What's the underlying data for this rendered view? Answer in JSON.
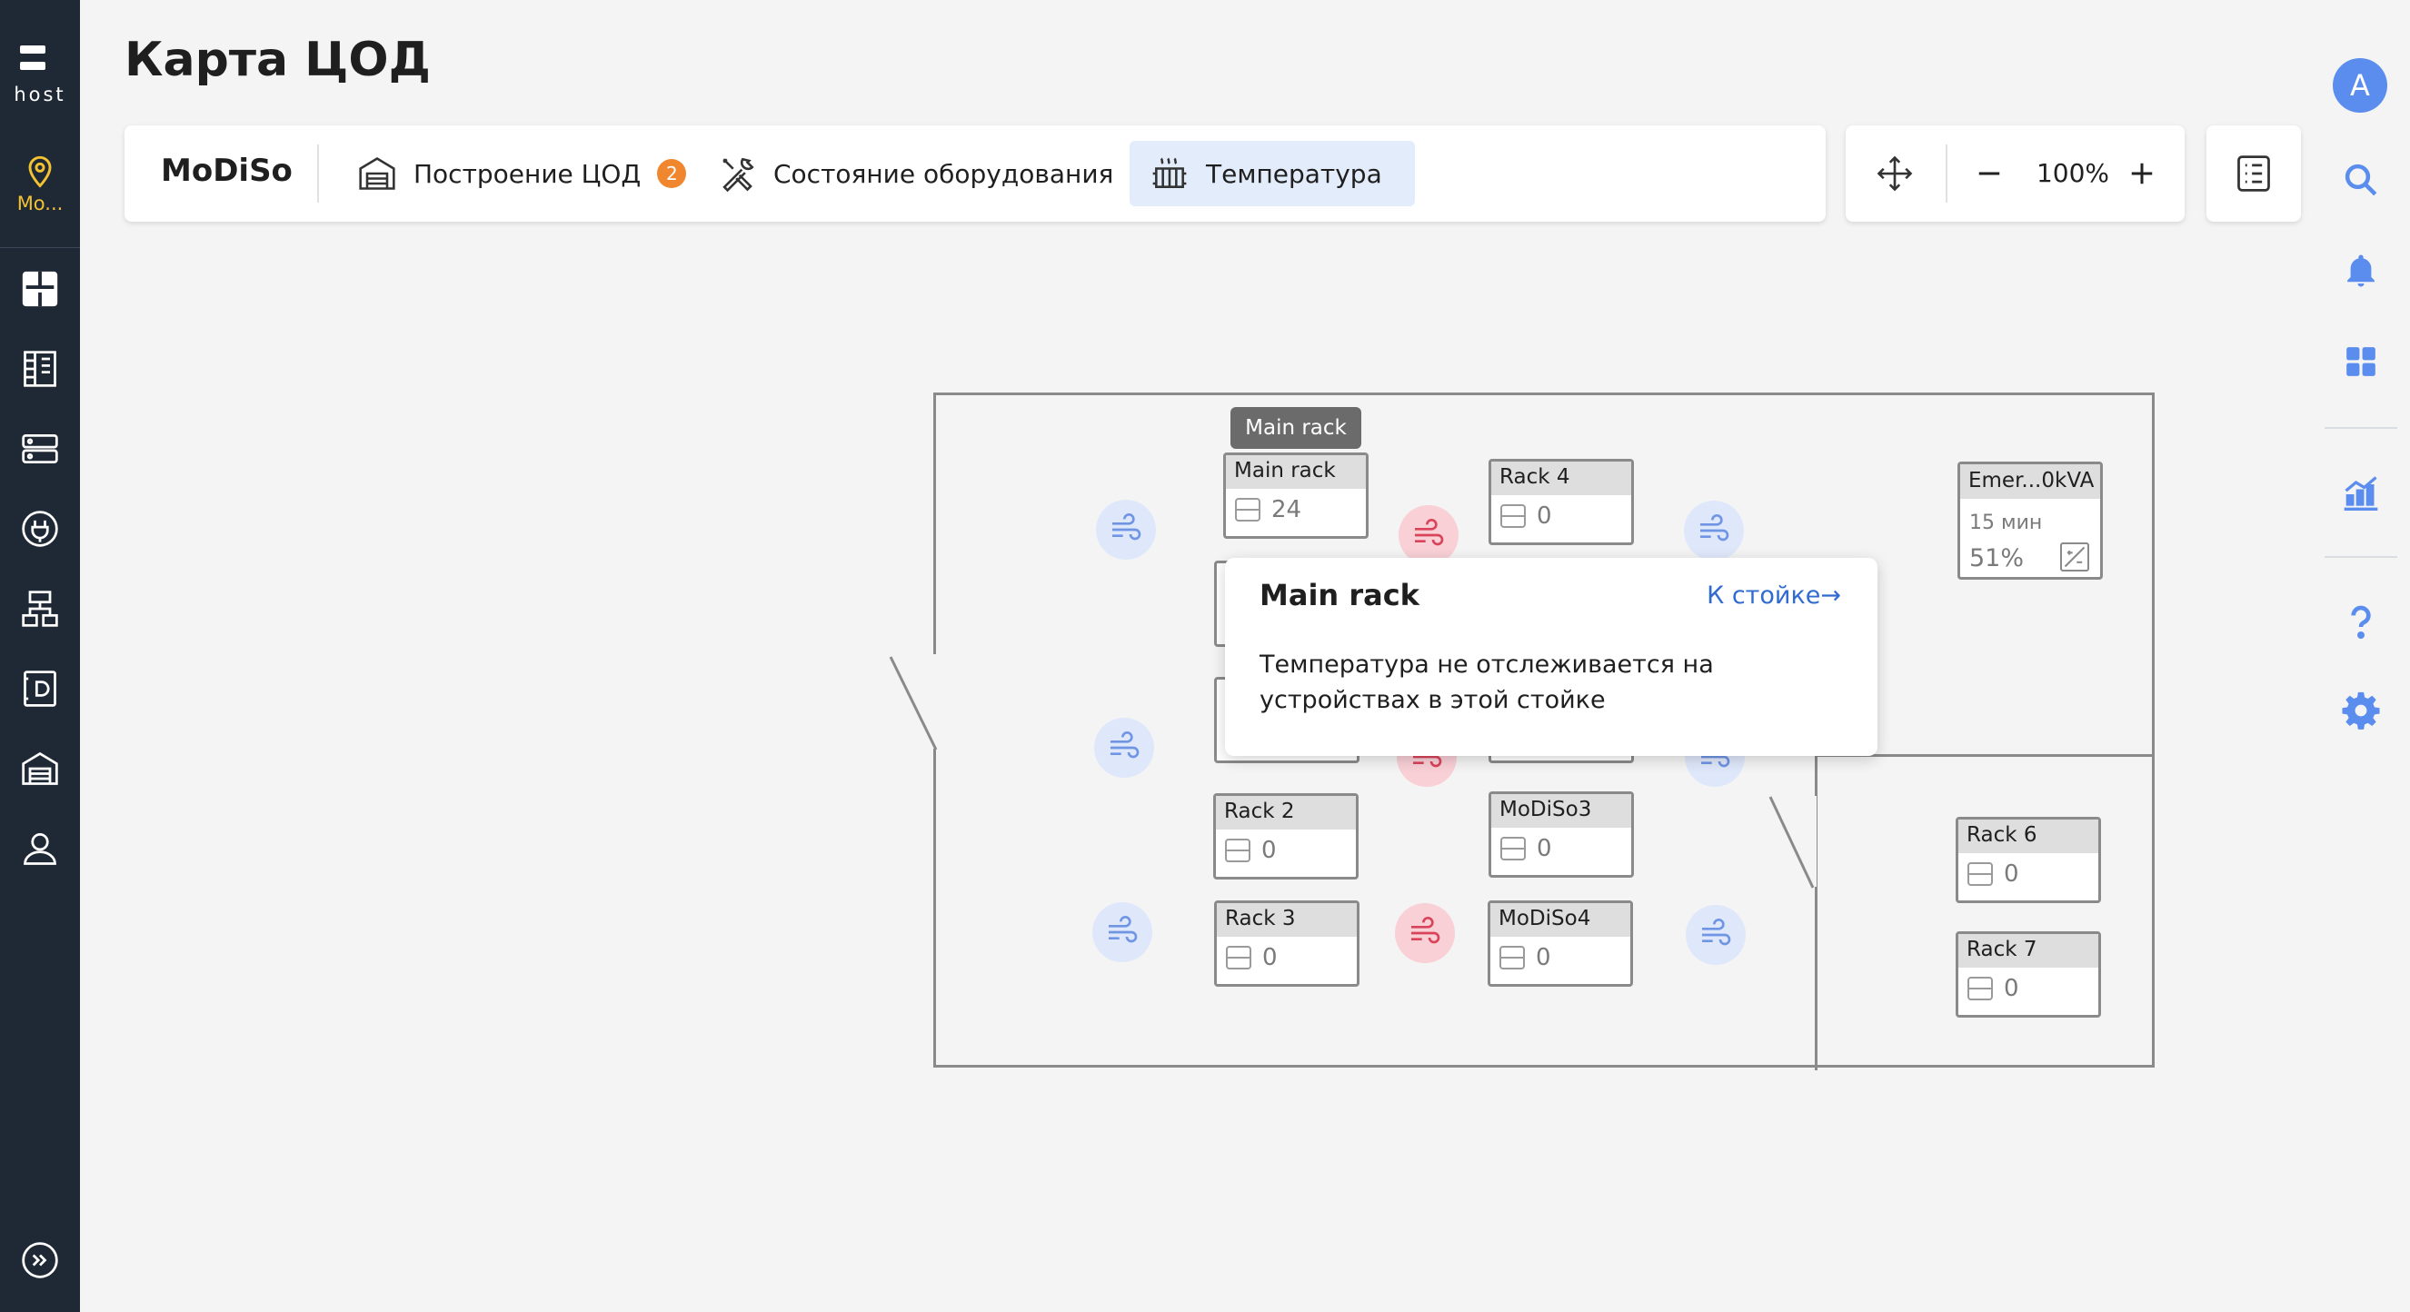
{
  "app": {
    "logo_text": "host",
    "location_label": "Mo..."
  },
  "page": {
    "title": "Карта ЦОД"
  },
  "toolbar": {
    "brand": "MoDiSo",
    "tabs": [
      {
        "label": "Построение ЦОД",
        "badge": "2",
        "icon": "building-icon"
      },
      {
        "label": "Состояние оборудования",
        "icon": "tools-icon"
      },
      {
        "label": "Температура",
        "icon": "heater-icon",
        "active": true
      }
    ],
    "zoom_value": "100%"
  },
  "user": {
    "avatar_letter": "A"
  },
  "floor": {
    "tooltip_label": "Main rack",
    "racks": [
      {
        "name": "Main rack",
        "count": "24"
      },
      {
        "name": "Rack 4",
        "count": "0"
      },
      {
        "name": "Rack 2",
        "count": "0"
      },
      {
        "name": "MoDiSo3",
        "count": "0"
      },
      {
        "name": "Rack 3",
        "count": "0"
      },
      {
        "name": "MoDiSo4",
        "count": "0"
      },
      {
        "name": "Rack 6",
        "count": "0"
      },
      {
        "name": "Rack 7",
        "count": "0"
      }
    ],
    "ups": {
      "name": "Emer...0kVA",
      "time": "15 мин",
      "percent": "51%"
    }
  },
  "popup": {
    "title": "Main rack",
    "link": "К стойке",
    "text": "Температура не отслеживается на устройствах в этой стойке"
  },
  "colors": {
    "sidebar": "#1f2835",
    "accent": "#2f6bd0",
    "location": "#f2c232",
    "badge": "#f0872e",
    "active_tab": "#e3ecfb"
  }
}
